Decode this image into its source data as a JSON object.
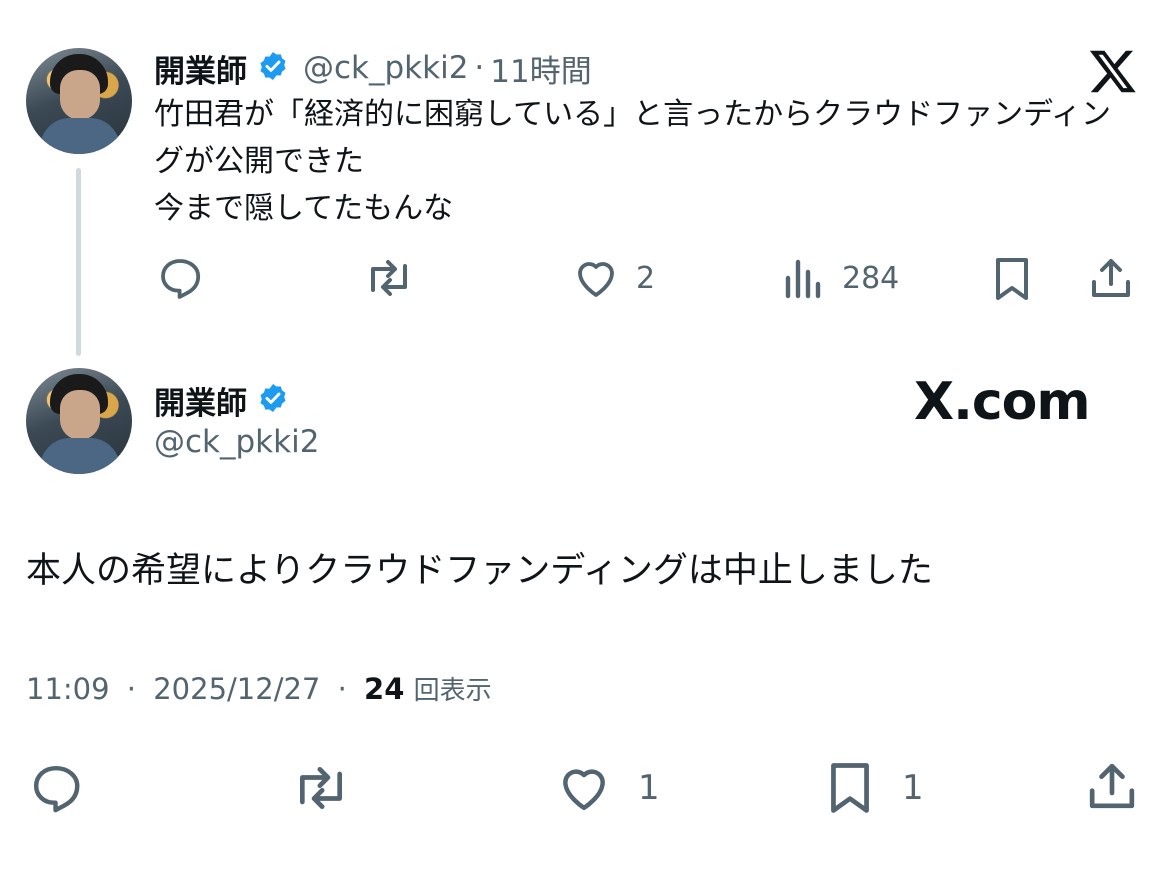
{
  "brand_mark": "X",
  "brand_domain": "X.com",
  "first_tweet": {
    "author_name": "開業師",
    "author_handle": "@ck_pkki2",
    "separator": "·",
    "time_ago": "11時間",
    "text": "竹田君が「経済的に困窮している」と言ったからクラウドファンディングが公開できた\n今まで隠してたもんな",
    "actions": {
      "reply_count": "",
      "repost_count": "",
      "like_count": "2",
      "view_count": "284"
    }
  },
  "second_tweet": {
    "author_name": "開業師",
    "author_handle": "@ck_pkki2",
    "text": "本人の希望によりクラウドファンディングは中止しました",
    "meta": {
      "time": "11:09",
      "separator": "·",
      "date": "2025/12/27",
      "views_count": "24",
      "views_label": "回表示"
    },
    "actions": {
      "like_count": "1",
      "bookmark_count": "1"
    }
  },
  "colors": {
    "text": "#0f1419",
    "muted": "#536471",
    "verified": "#1d9bf0",
    "thread_line": "#cfd9de"
  },
  "icons": [
    "reply-icon",
    "repost-icon",
    "like-icon",
    "views-icon",
    "bookmark-icon",
    "share-icon",
    "verified-badge-icon",
    "x-logo-icon"
  ]
}
